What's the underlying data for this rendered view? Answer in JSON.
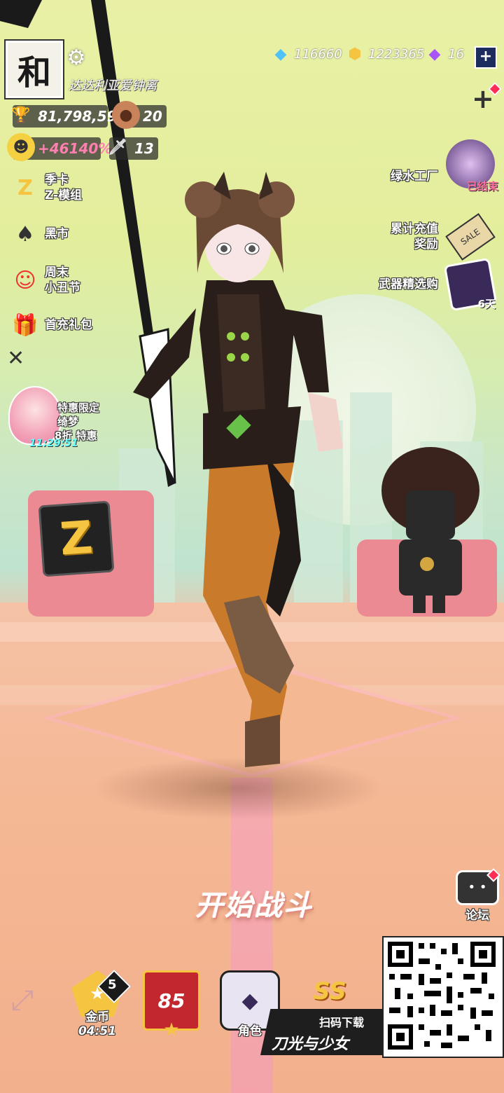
{
  "player": {
    "avatar_char": "和",
    "name": "达达利亚爱钟离"
  },
  "stats": {
    "trophies": "81,798,597",
    "pets": "20",
    "bonus": "+46140%",
    "weapons": "13"
  },
  "left_menu": [
    {
      "line1": "季卡",
      "line2": "Z-模组",
      "icon": "z-card-icon"
    },
    {
      "line1": "黑市",
      "line2": "",
      "icon": "spade-icon"
    },
    {
      "line1": "周末",
      "line2": "小丑节",
      "icon": "clown-icon"
    },
    {
      "line1": "首充礼包",
      "line2": "",
      "icon": "gift-icon"
    }
  ],
  "promo": {
    "line1": "特惠限定",
    "line2": "绮梦",
    "line3": "8折 特惠",
    "timer": "11:29:51"
  },
  "resources": {
    "gems": "116660",
    "gold": "1223365",
    "crystals": "16"
  },
  "right_menu": [
    {
      "label": "绿水工厂",
      "badge": "已结束"
    },
    {
      "label": "累计充值\n奖励",
      "badge": "SALE"
    },
    {
      "label": "武器精选购",
      "badge": "6天"
    }
  ],
  "start_button": "开始战斗",
  "forum": "论坛",
  "bottom": {
    "coin_label": "金币",
    "coin_timer": "04:51",
    "coin_count": "5",
    "level": "85",
    "role_label": "角色",
    "rank": "SS"
  },
  "qr_banner": {
    "scan": "扫码下载",
    "title": "刀光与少女"
  },
  "colors": {
    "sky": "#e9f0a6",
    "floor": "#f4b191",
    "accent_blue": "#1d2c5e",
    "gold": "#f5c542"
  }
}
